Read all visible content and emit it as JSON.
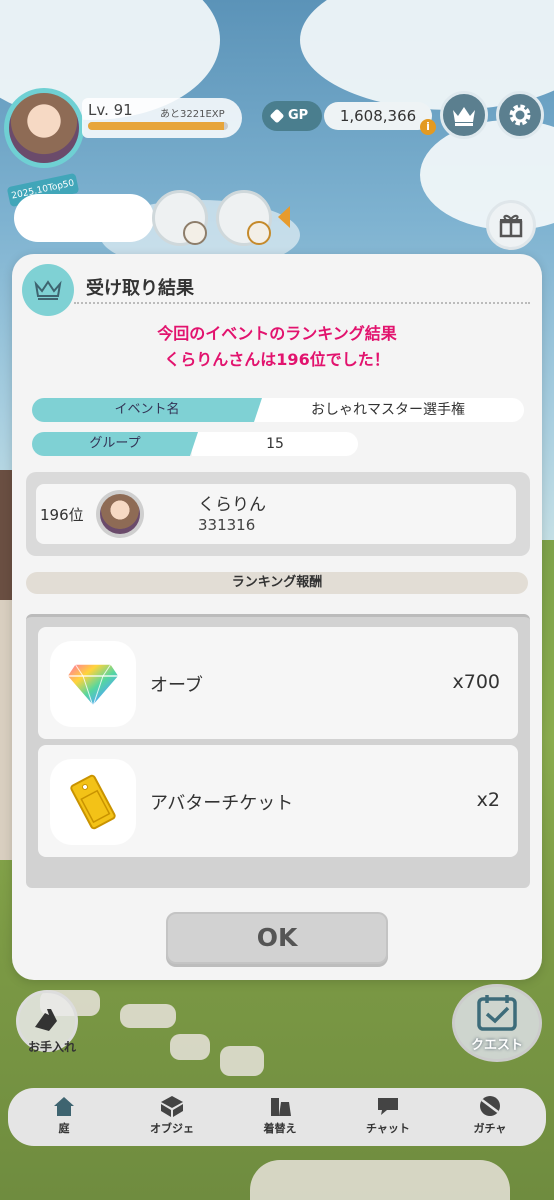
{
  "hud": {
    "level": "Lv. 91",
    "exp_remaining": "あと3221EXP",
    "exp_progress": 0.97,
    "gp_label": "GP",
    "gp_value": "1,608,366",
    "gp_info": "i",
    "banner": "2025.10Top50"
  },
  "modal": {
    "title": "受け取り結果",
    "message_line1": "今回のイベントのランキング結果",
    "message_line2": "くらりんさんは196位でした！",
    "event_label": "イベント名",
    "event_value": "おしゃれマスター選手権",
    "group_label": "グループ",
    "group_value": "15",
    "rank": {
      "position": "196位",
      "name": "くらりん",
      "score": "331316"
    },
    "reward_header": "ランキング報酬",
    "rewards": [
      {
        "name": "オーブ",
        "qty": "x700",
        "icon": "orb-gem-icon"
      },
      {
        "name": "アバターチケット",
        "qty": "x2",
        "icon": "avatar-ticket-icon"
      }
    ],
    "ok_label": "OK"
  },
  "side": {
    "care_label": "お手入れ",
    "quest_label": "クエスト"
  },
  "tabs": [
    {
      "label": "庭",
      "icon": "home-icon"
    },
    {
      "label": "オブジェ",
      "icon": "object-icon"
    },
    {
      "label": "着替え",
      "icon": "dress-up-icon"
    },
    {
      "label": "チャット",
      "icon": "chat-icon"
    },
    {
      "label": "ガチャ",
      "icon": "gacha-icon"
    }
  ],
  "colors": {
    "accent_teal": "#7fd1d4",
    "highlight_pink": "#e2136e",
    "exp_orange": "#e7a53b"
  }
}
